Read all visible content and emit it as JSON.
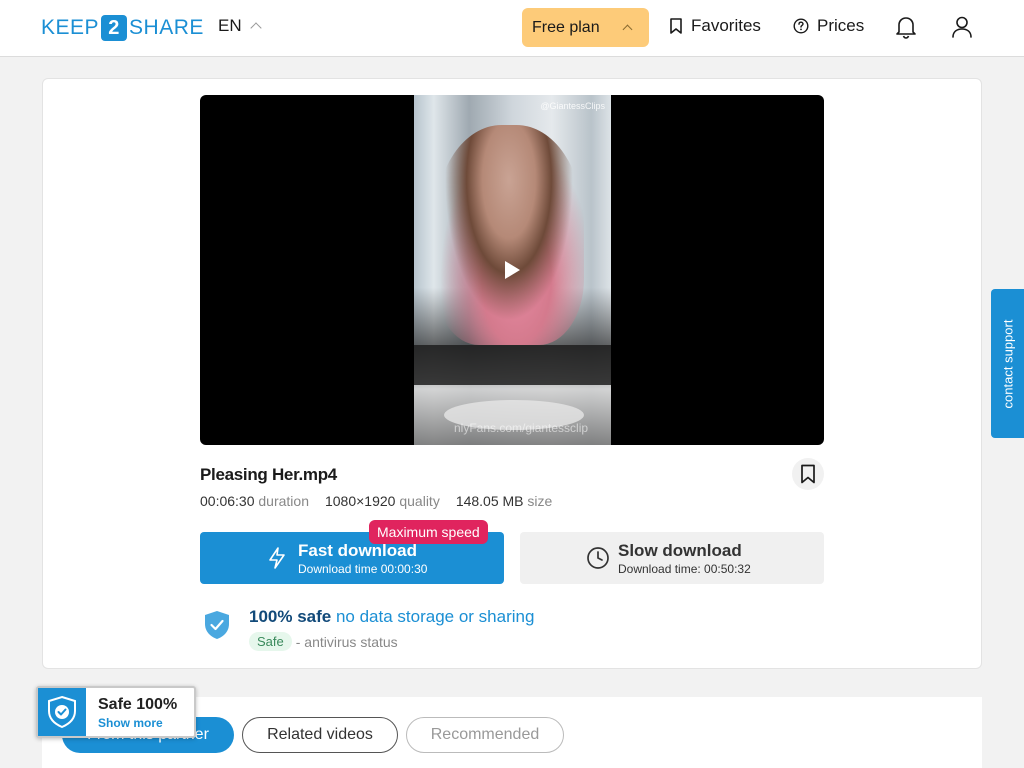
{
  "header": {
    "logo": {
      "left": "KEEP",
      "mid": "2",
      "right": "SHARE"
    },
    "lang": "EN",
    "plan_label": "Free plan",
    "favorites_label": "Favorites",
    "prices_label": "Prices"
  },
  "player": {
    "watermark_top": "@GiantessClips",
    "watermark_bottom": "nlyFans.com/giantessclip"
  },
  "file": {
    "name": "Pleasing Her.mp4",
    "duration": "00:06:30",
    "duration_label": "duration",
    "resolution": "1080×1920",
    "resolution_label": "quality",
    "size": "148.05 MB",
    "size_label": "size"
  },
  "downloads": {
    "fast_title": "Fast download",
    "fast_sub": "Download time 00:00:30",
    "fast_badge": "Maximum speed",
    "slow_title": "Slow download",
    "slow_sub": "Download time: 00:50:32"
  },
  "safety": {
    "strong": "100% safe",
    "light": "no data storage or sharing",
    "status_pill": "Safe",
    "status_text": "- antivirus status"
  },
  "support_label": "contact support",
  "tabs": [
    {
      "label": "From this partner"
    },
    {
      "label": "Related videos"
    },
    {
      "label": "Recommended"
    }
  ],
  "safe_badge": {
    "title": "Safe 100%",
    "link": "Show more"
  },
  "colors": {
    "brand": "#1b8fd4",
    "plan": "#fdcb79",
    "badge": "#e0245e"
  }
}
